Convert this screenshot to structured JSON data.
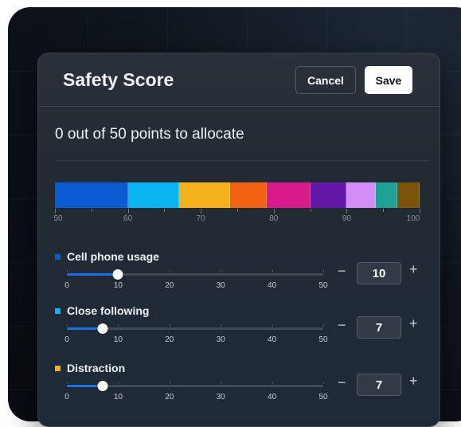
{
  "header": {
    "title": "Safety Score",
    "cancel_label": "Cancel",
    "save_label": "Save"
  },
  "allocation_text": "0 out of 50 points to allocate",
  "score_bar": {
    "min": 50,
    "max": 100,
    "axis_labels": [
      "50",
      "60",
      "70",
      "80",
      "90",
      "100"
    ],
    "segments": [
      {
        "value": 10,
        "color": "#0a5ad0"
      },
      {
        "value": 7,
        "color": "#0ab4f0"
      },
      {
        "value": 7,
        "color": "#f6b21c"
      },
      {
        "value": 5,
        "color": "#f26414"
      },
      {
        "value": 6,
        "color": "#d81a8c"
      },
      {
        "value": 5,
        "color": "#6418a8"
      },
      {
        "value": 4,
        "color": "#d28ef6"
      },
      {
        "value": 3,
        "color": "#1ea094"
      },
      {
        "value": 3,
        "color": "#7a5408"
      }
    ]
  },
  "sliders": [
    {
      "label": "Cell phone usage",
      "color": "#0a5ad0",
      "value": 10,
      "display": "10"
    },
    {
      "label": "Close following",
      "color": "#0ab4f0",
      "value": 7,
      "display": "7"
    },
    {
      "label": "Distraction",
      "color": "#f6b21c",
      "value": 7,
      "display": "7"
    }
  ],
  "slider_scale": {
    "min": 0,
    "max": 50,
    "labels": [
      "0",
      "10",
      "20",
      "30",
      "40",
      "50"
    ]
  },
  "stepper": {
    "minus": "−",
    "plus": "+"
  }
}
